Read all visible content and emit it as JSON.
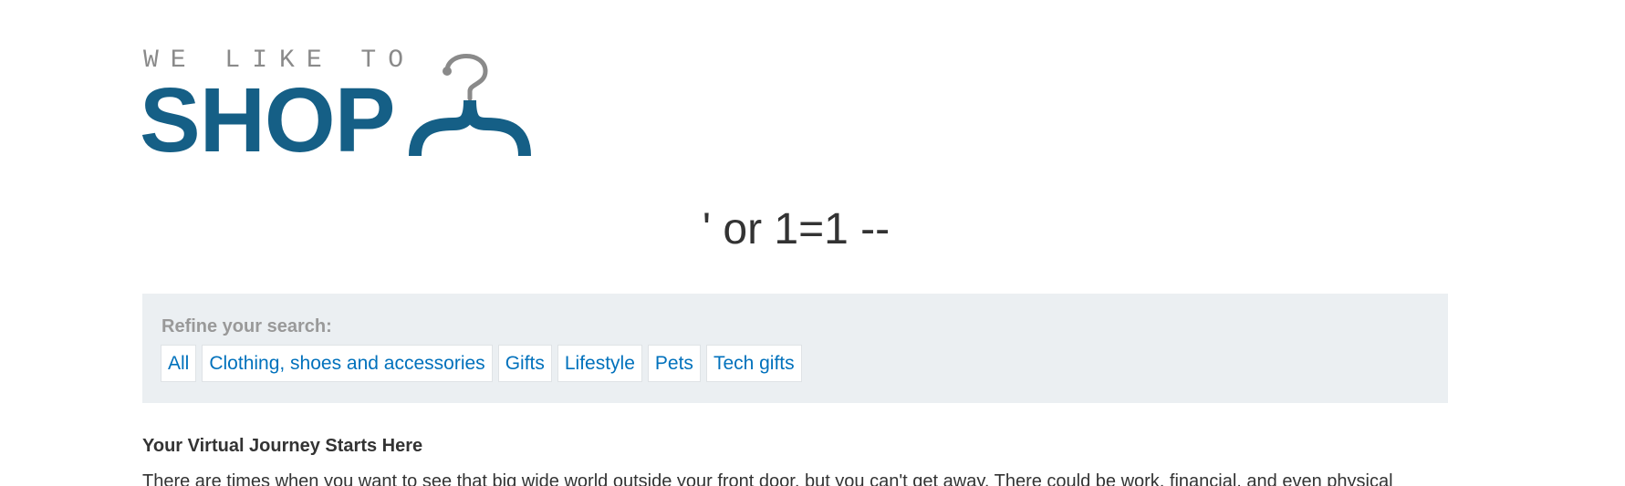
{
  "logo": {
    "top_text": "WE LIKE TO",
    "main_text": "SHOP",
    "icon": "hanger-icon",
    "colors": {
      "top": "#8a8a8a",
      "main": "#155f86",
      "hook": "#8a8a8a"
    }
  },
  "search": {
    "term": "' or 1=1 --"
  },
  "filters": {
    "label": "Refine your search:",
    "items": [
      {
        "label": "All"
      },
      {
        "label": "Clothing, shoes and accessories"
      },
      {
        "label": "Gifts"
      },
      {
        "label": "Lifestyle"
      },
      {
        "label": "Pets"
      },
      {
        "label": "Tech gifts"
      }
    ]
  },
  "blog": {
    "title": "Your Virtual Journey Starts Here",
    "excerpt": "There are times when you want to see that big wide world outside your front door, but you can't get away. There could be work, financial, and even physical"
  },
  "colors": {
    "link": "#0071bc",
    "panel_bg": "#ebeff2",
    "text": "#333333"
  }
}
